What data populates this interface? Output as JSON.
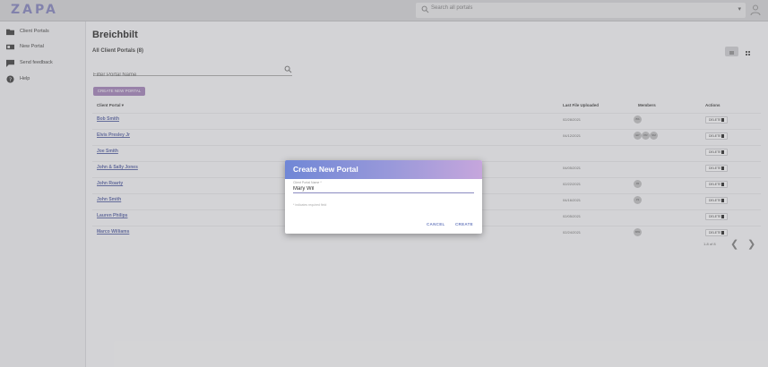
{
  "topbar": {
    "logo": "ZAPA",
    "search_placeholder": "Search all portals",
    "search_dropdown": "▾"
  },
  "sidebar": {
    "items": [
      {
        "label": "Client Portals",
        "icon": "folder-icon"
      },
      {
        "label": "New Portal",
        "icon": "new-portal-icon"
      },
      {
        "label": "Send feedback",
        "icon": "feedback-icon"
      },
      {
        "label": "Help",
        "icon": "help-icon"
      }
    ]
  },
  "main": {
    "title": "Breichbilt",
    "subtitle": "All Client Portals (8)",
    "filter_placeholder": "Filter Portal Name",
    "create_button": "CREATE NEW PORTAL",
    "columns": {
      "client_portal": "Client Portal ▾",
      "last_file": "Last File Uploaded",
      "members": "Members",
      "actions": "Actions"
    },
    "rows": [
      {
        "name": "Bob Smith",
        "date": "02/28/2021",
        "members": [
          "BS"
        ]
      },
      {
        "name": "Elvis Presley Jr",
        "date": "04/12/2021",
        "members": [
          "EP",
          "PR",
          "SM"
        ]
      },
      {
        "name": "Joe Smith",
        "date": "",
        "members": []
      },
      {
        "name": "John & Sally Jones",
        "date": "04/05/2021",
        "members": []
      },
      {
        "name": "John Roarty",
        "date": "02/22/2021",
        "members": [
          "JR"
        ]
      },
      {
        "name": "John Smith",
        "date": "04/16/2021",
        "members": [
          "JS"
        ]
      },
      {
        "name": "Lauren Philips",
        "date": "02/05/2021",
        "members": []
      },
      {
        "name": "Marco Williams",
        "date": "02/24/2021",
        "members": [
          "MW"
        ]
      }
    ],
    "delete_label": "DELETE",
    "pager_text": "1-8 of 8",
    "prev": "❮",
    "next": "❯"
  },
  "dialog": {
    "title": "Create New Portal",
    "field_label": "Client Portal Name *",
    "field_value": "Mary Wil",
    "helper": "* indicates required field",
    "cancel": "CANCEL",
    "create": "CREATE"
  },
  "colors": {
    "accent": "#7087d6",
    "header_gradient_end": "#c6a6dc",
    "link": "#6a73a8",
    "create_button": "#a58bb8"
  }
}
